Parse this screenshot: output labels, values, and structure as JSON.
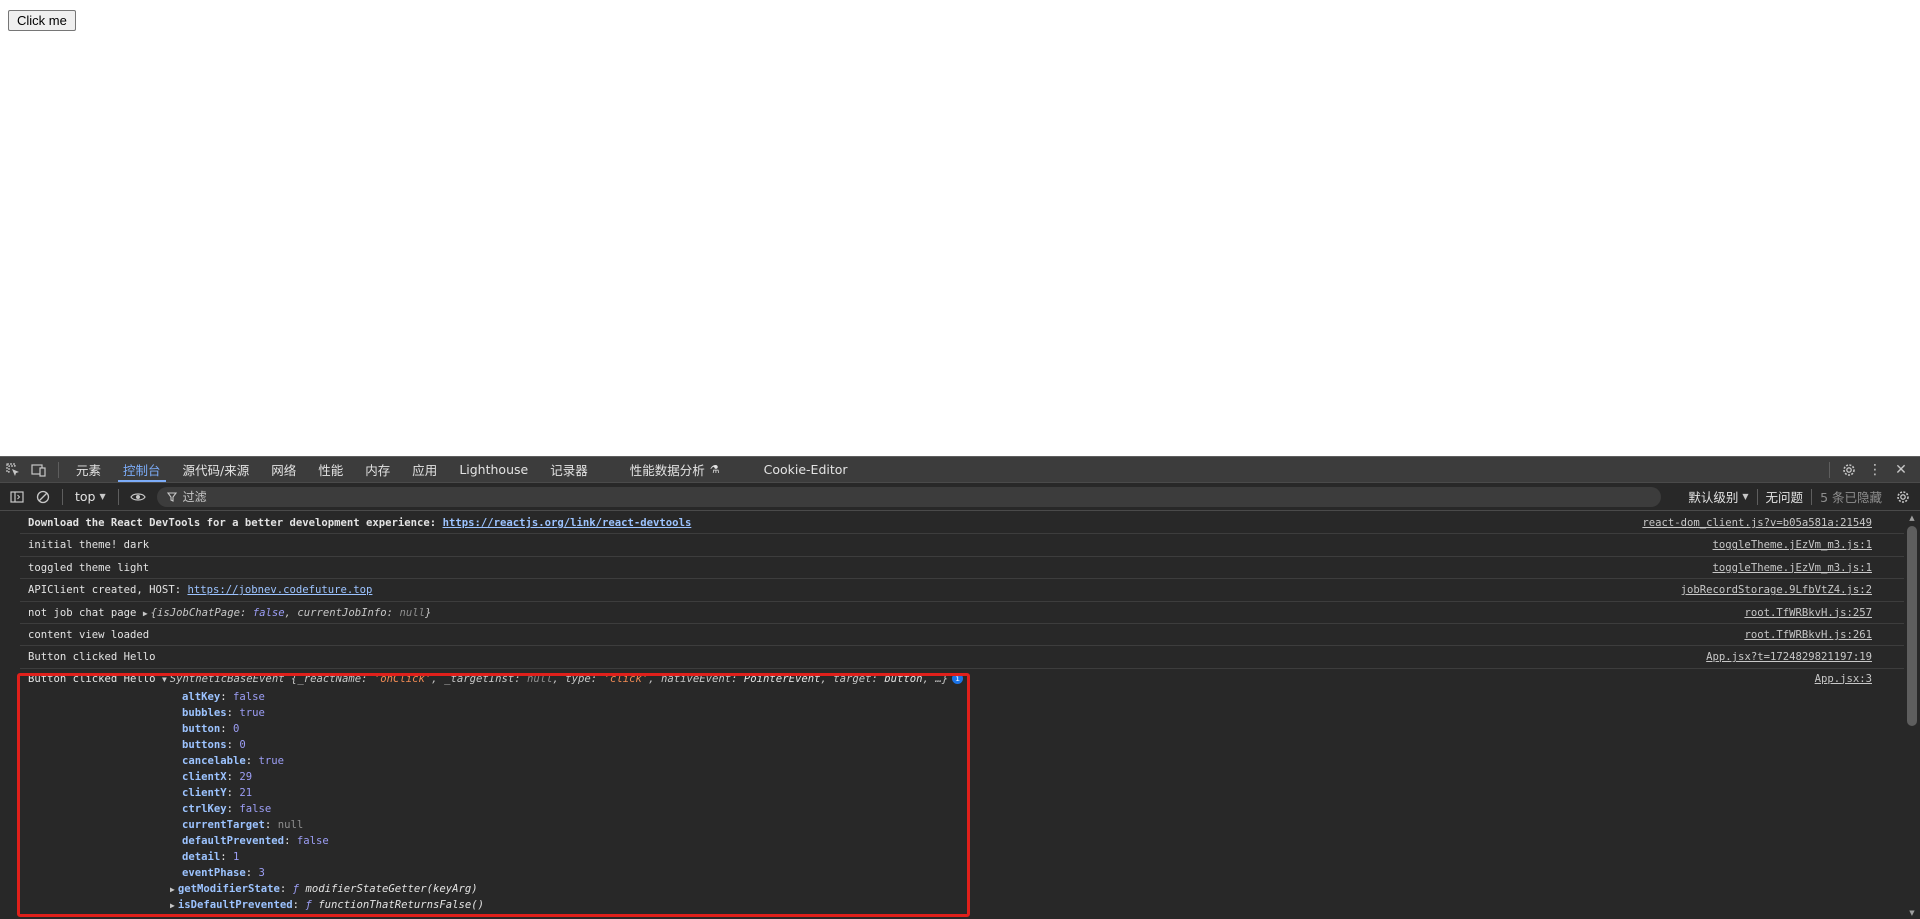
{
  "page": {
    "button_label": "Click me"
  },
  "devtools": {
    "tabs": [
      {
        "label": "元素"
      },
      {
        "label": "控制台"
      },
      {
        "label": "源代码/来源"
      },
      {
        "label": "网络"
      },
      {
        "label": "性能"
      },
      {
        "label": "内存"
      },
      {
        "label": "应用"
      },
      {
        "label": "Lighthouse"
      },
      {
        "label": "记录器"
      },
      {
        "label": "性能数据分析"
      },
      {
        "label": "Cookie-Editor"
      }
    ],
    "active_tab": "控制台",
    "toolbar": {
      "context": "top",
      "filter_placeholder": "过滤",
      "levels": "默认级别",
      "issues": "无问题",
      "hidden": "5 条已隐藏"
    },
    "messages": [
      {
        "bold_text": "Download the React DevTools for a better development experience: ",
        "link": "https://reactjs.org/link/react-devtools",
        "source": "react-dom_client.js?v=b05a581a:21549"
      },
      {
        "text": "initial theme! dark",
        "source": "toggleTheme.jEzVm_m3.js:1"
      },
      {
        "text": "toggled theme light",
        "source": "toggleTheme.jEzVm_m3.js:1"
      },
      {
        "text": "APIClient created, HOST: ",
        "link": "https://jobnev.codefuture.top",
        "source": "jobRecordStorage.9LfbVtZ4.js:2"
      },
      {
        "text": "not job chat page ",
        "preview_key1": "isJobChatPage",
        "preview_val1": "false",
        "preview_key2": "currentJobInfo",
        "preview_val2": "null",
        "source": "root.TfWRBkvH.js:257"
      },
      {
        "text": "content view loaded",
        "source": "root.TfWRBkvH.js:261"
      },
      {
        "text": "Button clicked Hello",
        "source": "App.jsx?t=1724829821197:19"
      }
    ],
    "expanded": {
      "text": "Button clicked Hello ",
      "class_name": "SyntheticBaseEvent",
      "preview": {
        "k1": "_reactName",
        "v1": "'onClick'",
        "k2": "_targetInst",
        "v2": "null",
        "k3": "type",
        "v3": "'click'",
        "k4": "nativeEvent",
        "v4": "PointerEvent",
        "k5": "target",
        "v5": "button",
        "ellipsis": "…"
      },
      "info": "i",
      "source": "App.jsx:3",
      "props": [
        {
          "key": "altKey",
          "value": "false",
          "kind": "bool"
        },
        {
          "key": "bubbles",
          "value": "true",
          "kind": "bool"
        },
        {
          "key": "button",
          "value": "0",
          "kind": "num"
        },
        {
          "key": "buttons",
          "value": "0",
          "kind": "num"
        },
        {
          "key": "cancelable",
          "value": "true",
          "kind": "bool"
        },
        {
          "key": "clientX",
          "value": "29",
          "kind": "num"
        },
        {
          "key": "clientY",
          "value": "21",
          "kind": "num"
        },
        {
          "key": "ctrlKey",
          "value": "false",
          "kind": "bool"
        },
        {
          "key": "currentTarget",
          "value": "null",
          "kind": "null"
        },
        {
          "key": "defaultPrevented",
          "value": "false",
          "kind": "bool"
        },
        {
          "key": "detail",
          "value": "1",
          "kind": "num"
        },
        {
          "key": "eventPhase",
          "value": "3",
          "kind": "num"
        }
      ],
      "fn_props": [
        {
          "key": "getModifierState",
          "fn_kw": "ƒ",
          "value": "modifierStateGetter(keyArg)"
        },
        {
          "key": "isDefaultPrevented",
          "fn_kw": "ƒ",
          "value": "functionThatReturnsFalse()"
        }
      ]
    }
  }
}
